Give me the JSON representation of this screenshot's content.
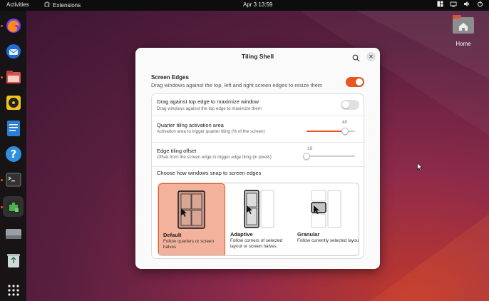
{
  "topbar": {
    "activities": "Activities",
    "extensions": "Extensions",
    "clock": "Apr 3  13:59"
  },
  "desktop": {
    "home_label": "Home"
  },
  "dock": {
    "items": [
      {
        "icon": "firefox-icon"
      },
      {
        "icon": "thunderbird-icon"
      },
      {
        "icon": "files-icon"
      },
      {
        "icon": "rhythmbox-icon"
      },
      {
        "icon": "writer-icon"
      },
      {
        "icon": "help-icon"
      },
      {
        "icon": "terminal-icon"
      },
      {
        "icon": "extensions-app-icon"
      },
      {
        "icon": "disk-icon"
      },
      {
        "icon": "trash-icon"
      },
      {
        "icon": "app-grid-icon"
      }
    ]
  },
  "dialog": {
    "title": "Tiling Shell",
    "section_title": "Screen Edges",
    "section_subtitle": "Drag windows against the top, left and right screen edges to resize them",
    "screen_edges_enabled": true,
    "rows": {
      "maximize": {
        "title": "Drag against top edge to maximize window",
        "subtitle": "Drag windows against the top edge to maximize them",
        "enabled": false
      },
      "quarter": {
        "title": "Quarter tiling activation area",
        "subtitle": "Activation area to trigger quarter tiling (% of the screen)",
        "value": "40",
        "min": 0,
        "max": 50
      },
      "edge_offset": {
        "title": "Edge tiling offset",
        "subtitle": "Offset from the screen edge to trigger edge tiling (in pixels)",
        "value": "16",
        "min": 16,
        "max": 200
      }
    },
    "choose_label": "Choose how windows snap to screen edges",
    "options": [
      {
        "name": "Default",
        "description": "Follow quarters or screen halves",
        "selected": true
      },
      {
        "name": "Adaptive",
        "description": "Follow corners of selected layout or screen halves",
        "selected": false
      },
      {
        "name": "Granular",
        "description": "Follow currently selected layout",
        "selected": false
      }
    ]
  },
  "colors": {
    "accent": "#e95420",
    "selected_bg": "#f3b29b"
  }
}
